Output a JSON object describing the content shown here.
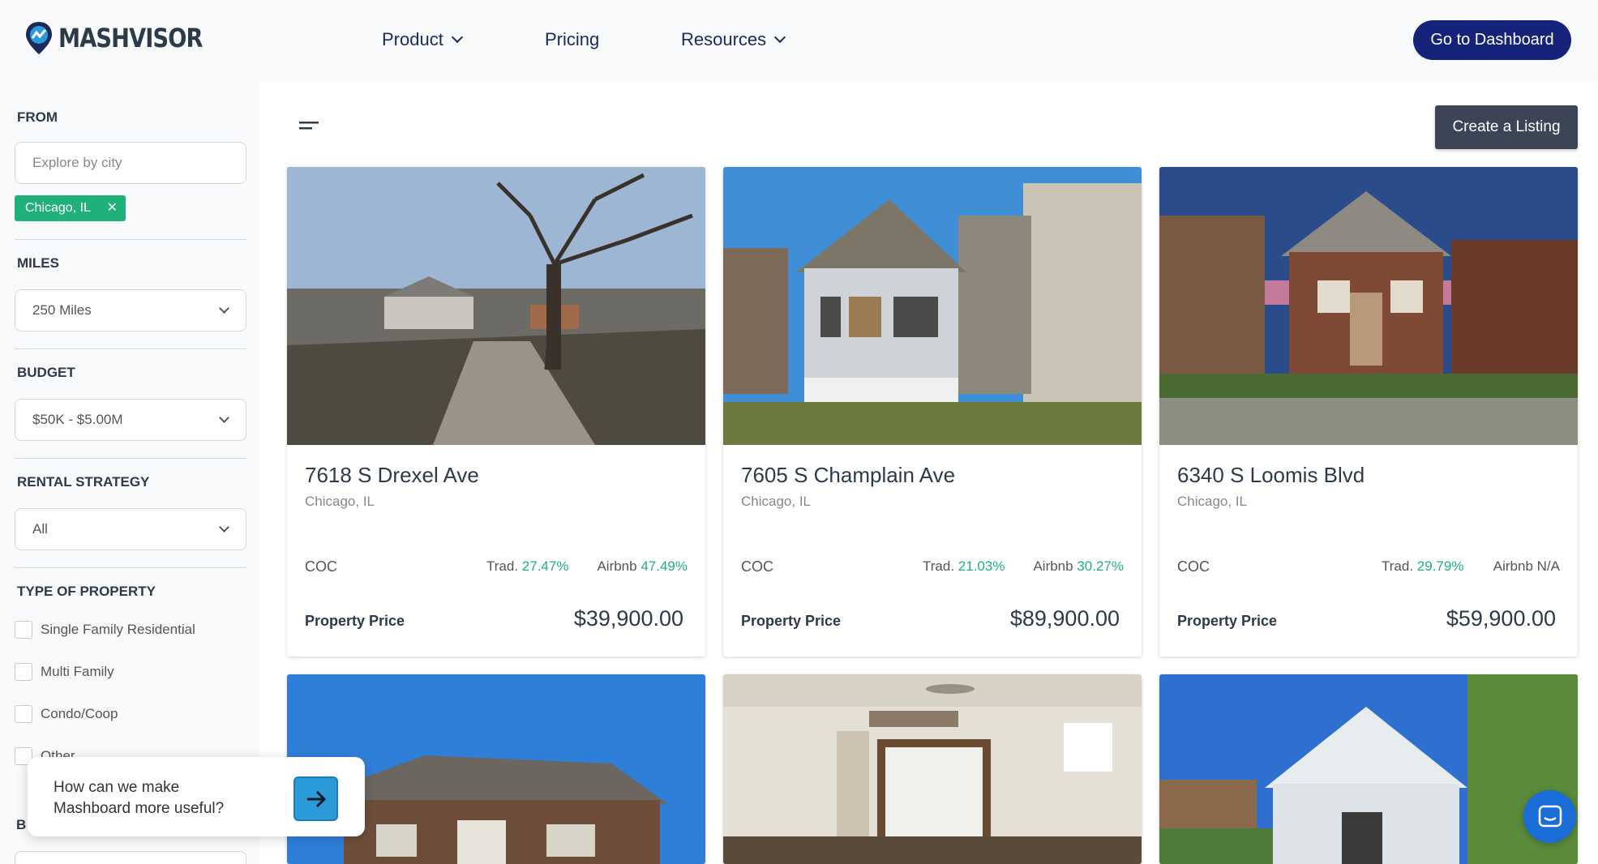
{
  "header": {
    "brand": "MASHVISOR",
    "nav": [
      {
        "label": "Product",
        "has_dropdown": true
      },
      {
        "label": "Pricing",
        "has_dropdown": false
      },
      {
        "label": "Resources",
        "has_dropdown": true
      }
    ],
    "dashboard_button": "Go to Dashboard"
  },
  "sidebar": {
    "from_label": "FROM",
    "city_placeholder": "Explore by city",
    "city_tag": "Chicago, IL",
    "miles_label": "MILES",
    "miles_value": "250 Miles",
    "budget_label": "BUDGET",
    "budget_value": "$50K - $5.00M",
    "strategy_label": "RENTAL STRATEGY",
    "strategy_value": "All",
    "property_type_label": "TYPE OF PROPERTY",
    "property_types": [
      "Single Family Residential",
      "Multi Family",
      "Condo/Coop",
      "Other"
    ],
    "next_section_partial": "B"
  },
  "toolbar": {
    "create_listing": "Create a Listing"
  },
  "coc_label": "COC",
  "trad_label": "Trad.",
  "airbnb_label": "Airbnb",
  "price_label": "Property Price",
  "listings": [
    {
      "address": "7618 S Drexel Ave",
      "city": "Chicago, IL",
      "trad": "27.47%",
      "airbnb": "47.49%",
      "price": "$39,900.00"
    },
    {
      "address": "7605 S Champlain Ave",
      "city": "Chicago, IL",
      "trad": "21.03%",
      "airbnb": "30.27%",
      "price": "$89,900.00"
    },
    {
      "address": "6340 S Loomis Blvd",
      "city": "Chicago, IL",
      "trad": "29.79%",
      "airbnb": "N/A",
      "price": "$59,900.00"
    }
  ],
  "feedback": {
    "text": "How can we make Mashboard more useful?"
  },
  "colors": {
    "brand_navy": "#15237a",
    "green": "#20b07a",
    "dark_button": "#3b4556",
    "chat_blue": "#1a6cd6"
  }
}
